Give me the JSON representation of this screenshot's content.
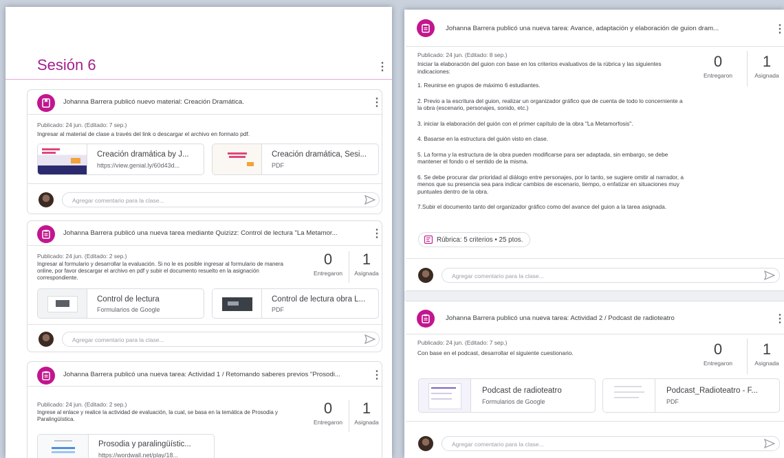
{
  "colors": {
    "accent": "#a3208d",
    "icon_bg": "#c2168e"
  },
  "left": {
    "section_title": "Sesión 6",
    "cards": [
      {
        "header": "Johanna Barrera publicó nuevo material: Creación Dramática.",
        "published": "Publicado: 24 jun. (Editado: 7 sep.)",
        "description": "Ingresar al material de clase a través del link o descargar el archivo en formato pdf.",
        "attachments": [
          {
            "title": "Creación dramática by J...",
            "subtitle": "https://view.genial.ly/60d43d..."
          },
          {
            "title": "Creación dramática, Sesi...",
            "subtitle": "PDF"
          }
        ],
        "comment_placeholder": "Agregar comentario para la clase..."
      },
      {
        "header": "Johanna Barrera publicó una nueva tarea mediante Quizizz: Control de lectura \"La Metamor...",
        "published": "Publicado: 24 jun. (Editado: 2 sep.)",
        "description": "Ingresar al formulario y desarrollar la evaluación. Si no le es posible ingresar al formulario de manera online, por favor descargar el archivo en pdf y subir el documento resuelto en la asignación correspondiente.",
        "stats": {
          "submitted": "0",
          "submitted_label": "Entregaron",
          "assigned": "1",
          "assigned_label": "Asignada"
        },
        "attachments": [
          {
            "title": "Control de lectura",
            "subtitle": "Formularios de Google"
          },
          {
            "title": "Control de lectura obra L...",
            "subtitle": "PDF"
          }
        ],
        "comment_placeholder": "Agregar comentario para la clase..."
      },
      {
        "header": "Johanna Barrera publicó una nueva tarea: Actividad 1 / Retomando saberes previos \"Prosodi...",
        "published": "Publicado: 24 jun. (Editado: 2 sep.)",
        "description": "Ingrese al enlace y realice la actividad de evaluación, la cual, se basa en la temática de Prosodia y Paralingüística.",
        "stats": {
          "submitted": "0",
          "submitted_label": "Entregaron",
          "assigned": "1",
          "assigned_label": "Asignada"
        },
        "attachments": [
          {
            "title": "Prosodia y paralingüístic...",
            "subtitle": "https://wordwall.net/play/18..."
          }
        ]
      }
    ]
  },
  "right": {
    "cards": [
      {
        "header": "Johanna Barrera publicó una nueva tarea: Avance, adaptación y elaboración de guion dram...",
        "published": "Publicado: 24 jun. (Editado: 8 sep.)",
        "paragraphs": [
          "Iniciar la elaboración del guion con base en los criterios evaluativos de la rúbrica y  las siguientes indicaciones:",
          "1. Reunirse en grupos  de máximo 6 estudiantes.",
          "2. Previo a la escritura del guion, realizar un organizador gráfico que de cuenta de todo lo concerniente a la obra (escenario, personajes, sonido, etc.)",
          "3. iniciar la elaboración del guión con el primer capítulo de la obra \"La Metamorfosis\".",
          "4. Basarse en la estructura del guión visto en clase.",
          "5. La forma y la estructura de la obra pueden modificarse para ser adaptada, sin embargo, se debe mantener el fondo o el sentido de la misma.",
          "6. Se debe procurar dar prioridad al diálogo entre personajes, por lo tanto, se sugiere omitir al narrador, a menos que su presencia sea para indicar cambios de escenario, tiempo, o enfatizar en situaciones muy puntuales dentro de la obra.",
          "7.Subir el  documento tanto del organizador gráfico como del avance del guion a la tarea asignada."
        ],
        "rubric": "Rúbrica: 5 criterios • 25 ptos.",
        "stats": {
          "submitted": "0",
          "submitted_label": "Entregaron",
          "assigned": "1",
          "assigned_label": "Asignada"
        },
        "comment_placeholder": "Agregar comentario para la clase..."
      },
      {
        "header": "Johanna Barrera publicó una nueva tarea: Actividad 2 / Podcast de radioteatro",
        "published": "Publicado: 24 jun. (Editado: 7 sep.)",
        "description": "Con base en el podcast, desarrollar el siguiente cuestionario.",
        "stats": {
          "submitted": "0",
          "submitted_label": "Entregaron",
          "assigned": "1",
          "assigned_label": "Asignada"
        },
        "attachments": [
          {
            "title": "Podcast de radioteatro",
            "subtitle": "Formularios de Google"
          },
          {
            "title": "Podcast_Radioteatro - F...",
            "subtitle": "PDF"
          }
        ],
        "comment_placeholder": "Agregar comentario para la clase..."
      }
    ]
  }
}
